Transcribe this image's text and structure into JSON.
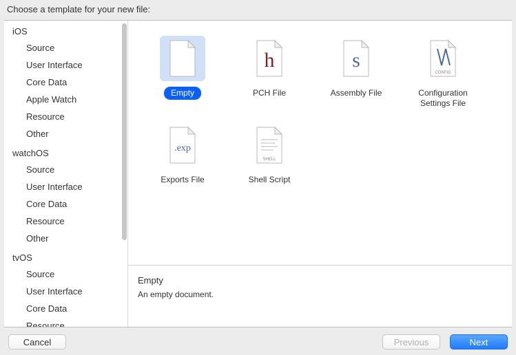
{
  "header": {
    "label": "Choose a template for your new file:"
  },
  "sidebar": {
    "groups": [
      {
        "title": "iOS",
        "items": [
          "Source",
          "User Interface",
          "Core Data",
          "Apple Watch",
          "Resource",
          "Other"
        ]
      },
      {
        "title": "watchOS",
        "items": [
          "Source",
          "User Interface",
          "Core Data",
          "Resource",
          "Other"
        ]
      },
      {
        "title": "tvOS",
        "items": [
          "Source",
          "User Interface",
          "Core Data",
          "Resource"
        ]
      }
    ]
  },
  "templates": [
    {
      "label": "Empty",
      "icon": "empty",
      "selected": true
    },
    {
      "label": "PCH File",
      "icon": "pch",
      "selected": false
    },
    {
      "label": "Assembly File",
      "icon": "asm",
      "selected": false
    },
    {
      "label": "Configuration Settings File",
      "icon": "config",
      "selected": false
    },
    {
      "label": "Exports File",
      "icon": "exp",
      "selected": false
    },
    {
      "label": "Shell Script",
      "icon": "shell",
      "selected": false
    }
  ],
  "description": {
    "title": "Empty",
    "text": "An empty document."
  },
  "footer": {
    "cancel": "Cancel",
    "previous": "Previous",
    "next": "Next"
  }
}
